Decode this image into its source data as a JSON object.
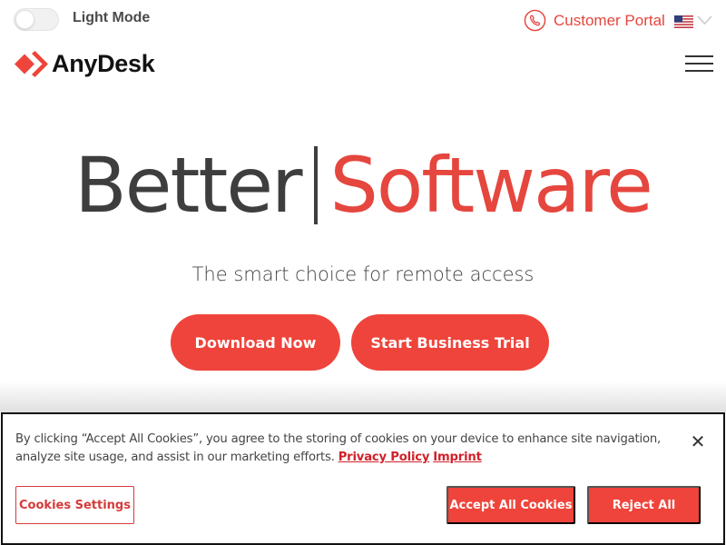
{
  "topbar": {
    "mode_toggle_on": false,
    "mode_label": "Light Mode",
    "portal_label": "Customer Portal",
    "portal_icon": "phone-icon",
    "language_flag": "us-flag-icon",
    "language_icon": "chevron-down-icon"
  },
  "header": {
    "logo_text": "AnyDesk",
    "logo_icon": "anydesk-diamond-logo",
    "menu_icon": "hamburger-menu-icon"
  },
  "hero": {
    "headline_part1": "Better",
    "headline_separator": "|",
    "headline_part2": "Software",
    "subtitle": "The smart choice for remote access",
    "primary_button": "Download Now",
    "secondary_button": "Start Business Trial"
  },
  "cookie_banner": {
    "text": "By clicking “Accept All Cookies”, you agree to the storing of cookies on your device to enhance site navigation, analyze site usage, and assist in our marketing efforts.",
    "privacy_link": "Privacy Policy",
    "imprint_link": "Imprint",
    "close_icon": "close-icon",
    "settings_button": "Cookies Settings",
    "accept_button": "Accept All Cookies",
    "reject_button": "Reject All"
  },
  "colors": {
    "brand_red": "#ef443b",
    "link_red": "#d1212a",
    "text_dark": "#3e3e3e"
  }
}
